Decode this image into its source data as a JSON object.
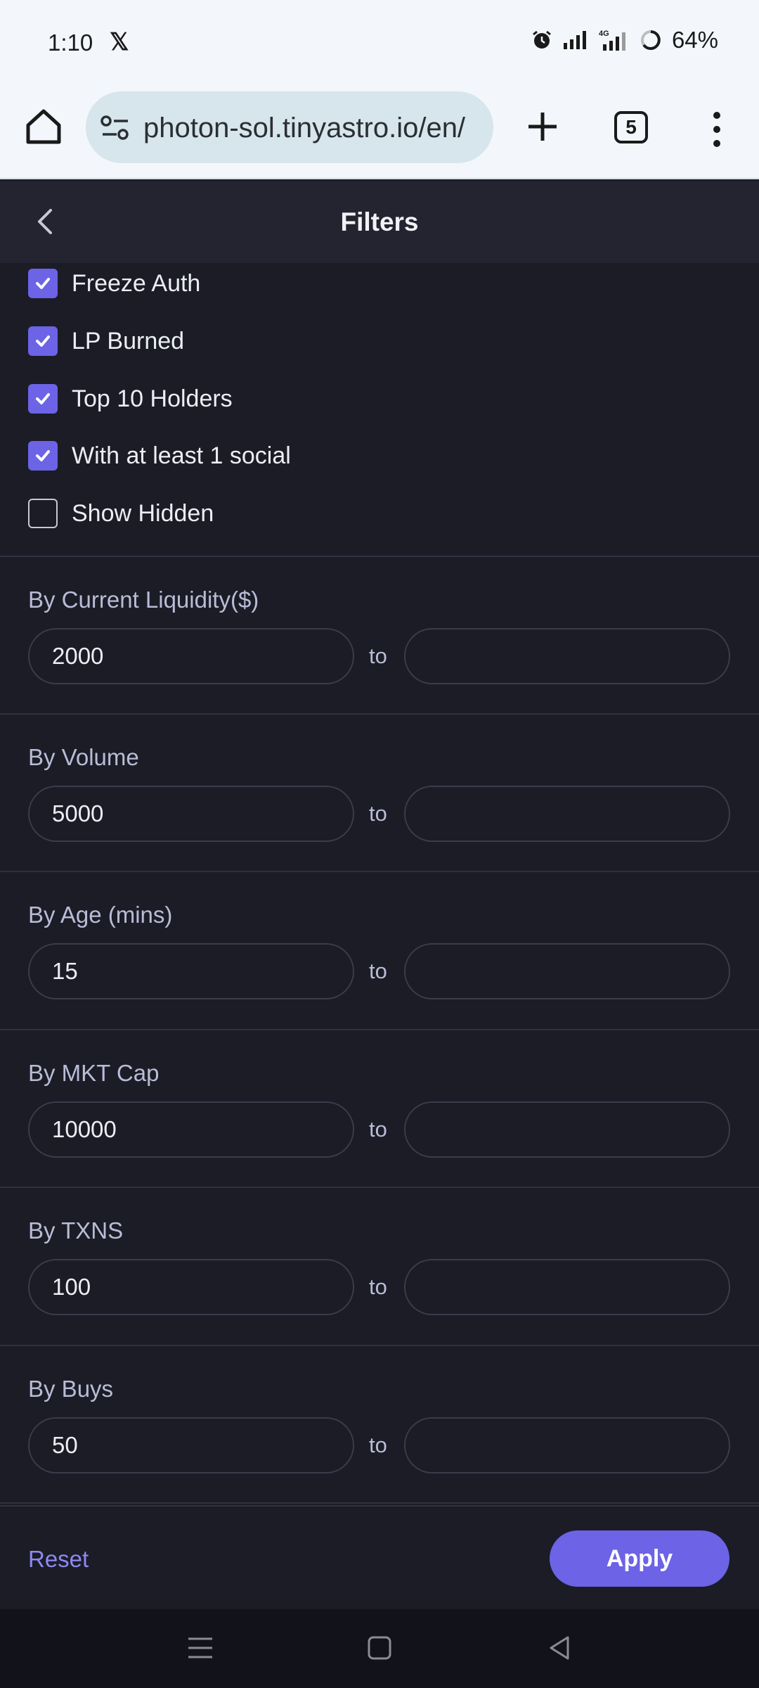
{
  "status_bar": {
    "time": "1:10",
    "notification_icon": "x-logo-icon",
    "battery": "64%"
  },
  "browser": {
    "url": "photon-sol.tinyastro.io/en/",
    "tab_count": "5"
  },
  "header": {
    "title": "Filters"
  },
  "checkboxes": [
    {
      "label": "Freeze Auth",
      "checked": true
    },
    {
      "label": "LP Burned",
      "checked": true
    },
    {
      "label": "Top 10 Holders",
      "checked": true
    },
    {
      "label": "With at least 1 social",
      "checked": true
    },
    {
      "label": "Show Hidden",
      "checked": false
    }
  ],
  "ranges": [
    {
      "label": "By Current Liquidity($)",
      "min": "2000",
      "max": "",
      "to": "to"
    },
    {
      "label": "By Volume",
      "min": "5000",
      "max": "",
      "to": "to"
    },
    {
      "label": "By Age (mins)",
      "min": "15",
      "max": "",
      "to": "to"
    },
    {
      "label": "By MKT Cap",
      "min": "10000",
      "max": "",
      "to": "to"
    },
    {
      "label": "By TXNS",
      "min": "100",
      "max": "",
      "to": "to"
    },
    {
      "label": "By Buys",
      "min": "50",
      "max": "",
      "to": "to"
    }
  ],
  "footer": {
    "reset_label": "Reset",
    "apply_label": "Apply"
  },
  "colors": {
    "accent": "#6c63e6",
    "background": "#1b1c26",
    "header": "#23242f"
  }
}
